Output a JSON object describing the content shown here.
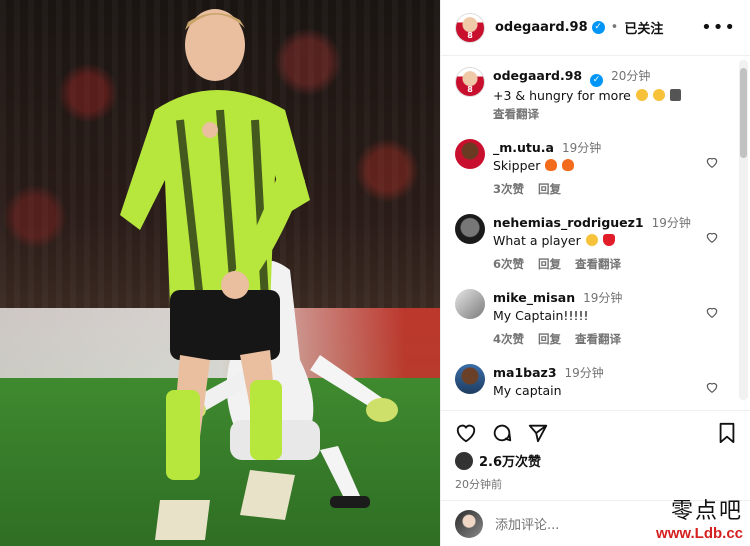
{
  "post": {
    "username": "odegaard.98",
    "follow_status": "已关注",
    "caption": "+3 & hungry for more",
    "caption_time": "20分钟",
    "see_translation": "查看翻译",
    "likes": "2.6万次赞",
    "posted_ago": "20分钟前",
    "add_comment_placeholder": "添加评论..."
  },
  "comments": [
    {
      "user": "_m.utu.a",
      "time": "19分钟",
      "text": "Skipper",
      "likes": "3次赞",
      "reply": "回复",
      "translate": ""
    },
    {
      "user": "nehemias_rodriguez1",
      "time": "19分钟",
      "text": "What a player",
      "likes": "6次赞",
      "reply": "回复",
      "translate": "查看翻译"
    },
    {
      "user": "mike_misan",
      "time": "19分钟",
      "text": "My Captain!!!!!",
      "likes": "4次赞",
      "reply": "回复",
      "translate": "查看翻译"
    },
    {
      "user": "ma1baz3",
      "time": "19分钟",
      "text": "My captain",
      "likes": "",
      "reply": "",
      "translate": ""
    }
  ],
  "watermark": {
    "cn": "零点吧",
    "url": "www.Ldb.cc"
  },
  "colors": {
    "verified": "#0095f6",
    "kit_green": "#b7e63c",
    "heart_red": "#e11d2a"
  }
}
